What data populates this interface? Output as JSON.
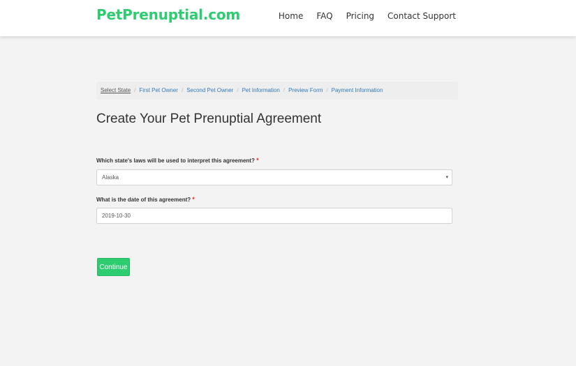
{
  "brand": {
    "name": "PetPrenuptial.com",
    "color": "#2ecc71"
  },
  "nav": {
    "items": [
      {
        "label": "Home"
      },
      {
        "label": "FAQ"
      },
      {
        "label": "Pricing"
      },
      {
        "label": "Contact Support"
      }
    ]
  },
  "breadcrumb": {
    "items": [
      {
        "label": "Select State"
      },
      {
        "label": "First Pet Owner"
      },
      {
        "label": "Second Pet Owner"
      },
      {
        "label": "Pet Information"
      },
      {
        "label": "Preview Form"
      },
      {
        "label": "Payment Information"
      }
    ],
    "separator": "/"
  },
  "page": {
    "title": "Create Your Pet Prenuptial Agreement"
  },
  "form": {
    "state_label": "Which state's laws will be used to interpret this agreement?",
    "state_value": "Alaska",
    "date_label": "What is the date of this agreement?",
    "date_value": "2019-10-30",
    "required_marker": "*",
    "continue_label": "Continue"
  },
  "colors": {
    "accent": "#2ecc71",
    "link": "#337ab7",
    "required": "#d9302e"
  }
}
